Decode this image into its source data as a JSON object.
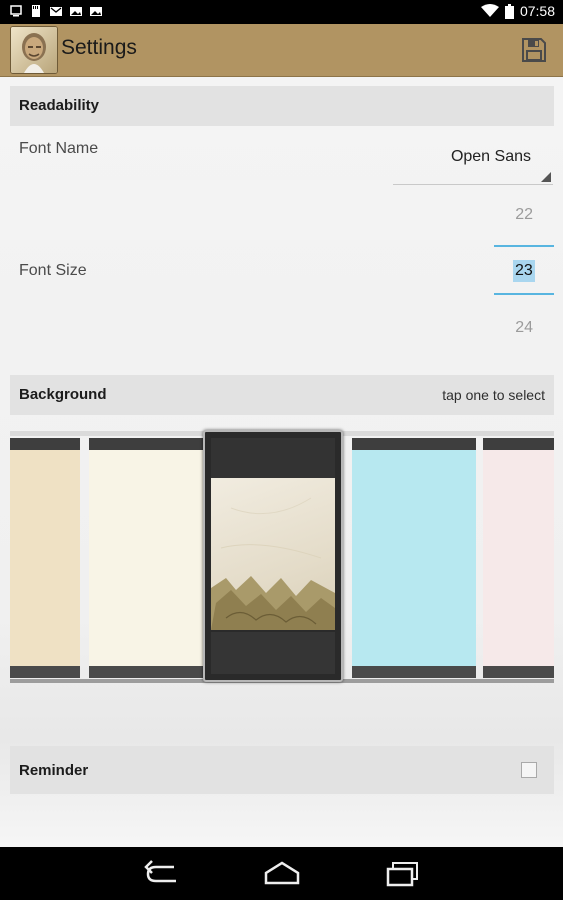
{
  "status_bar": {
    "time": "07:58",
    "icons_left": [
      "notification-icon",
      "sd-card-icon",
      "gmail-icon",
      "photo-icon",
      "photo-icon"
    ],
    "icons_right": [
      "wifi-icon",
      "battery-icon"
    ]
  },
  "action_bar": {
    "title": "Settings",
    "app_icon": "portrait-avatar-icon",
    "save_icon": "save-floppy-icon"
  },
  "readability": {
    "header": "Readability",
    "font_name_label": "Font Name",
    "font_name_value": "Open Sans",
    "font_size_label": "Font Size",
    "font_size_prev": "22",
    "font_size_selected": "23",
    "font_size_next": "24"
  },
  "background": {
    "header": "Background",
    "hint": "tap one to select",
    "tiles": [
      {
        "color": "#efe1c4"
      },
      {
        "color": "#f8f4e6"
      },
      {
        "color": "#e8e1cf",
        "selected": true
      },
      {
        "color": "#b7e8f0"
      },
      {
        "color": "#f6e9e9"
      }
    ]
  },
  "reminder": {
    "header": "Reminder",
    "checked": false
  },
  "colors": {
    "action_bar": "#b19462",
    "accent_blue": "#58b5e0"
  },
  "nav_bar": {
    "buttons": [
      "back-icon",
      "home-icon",
      "recent-apps-icon"
    ]
  }
}
